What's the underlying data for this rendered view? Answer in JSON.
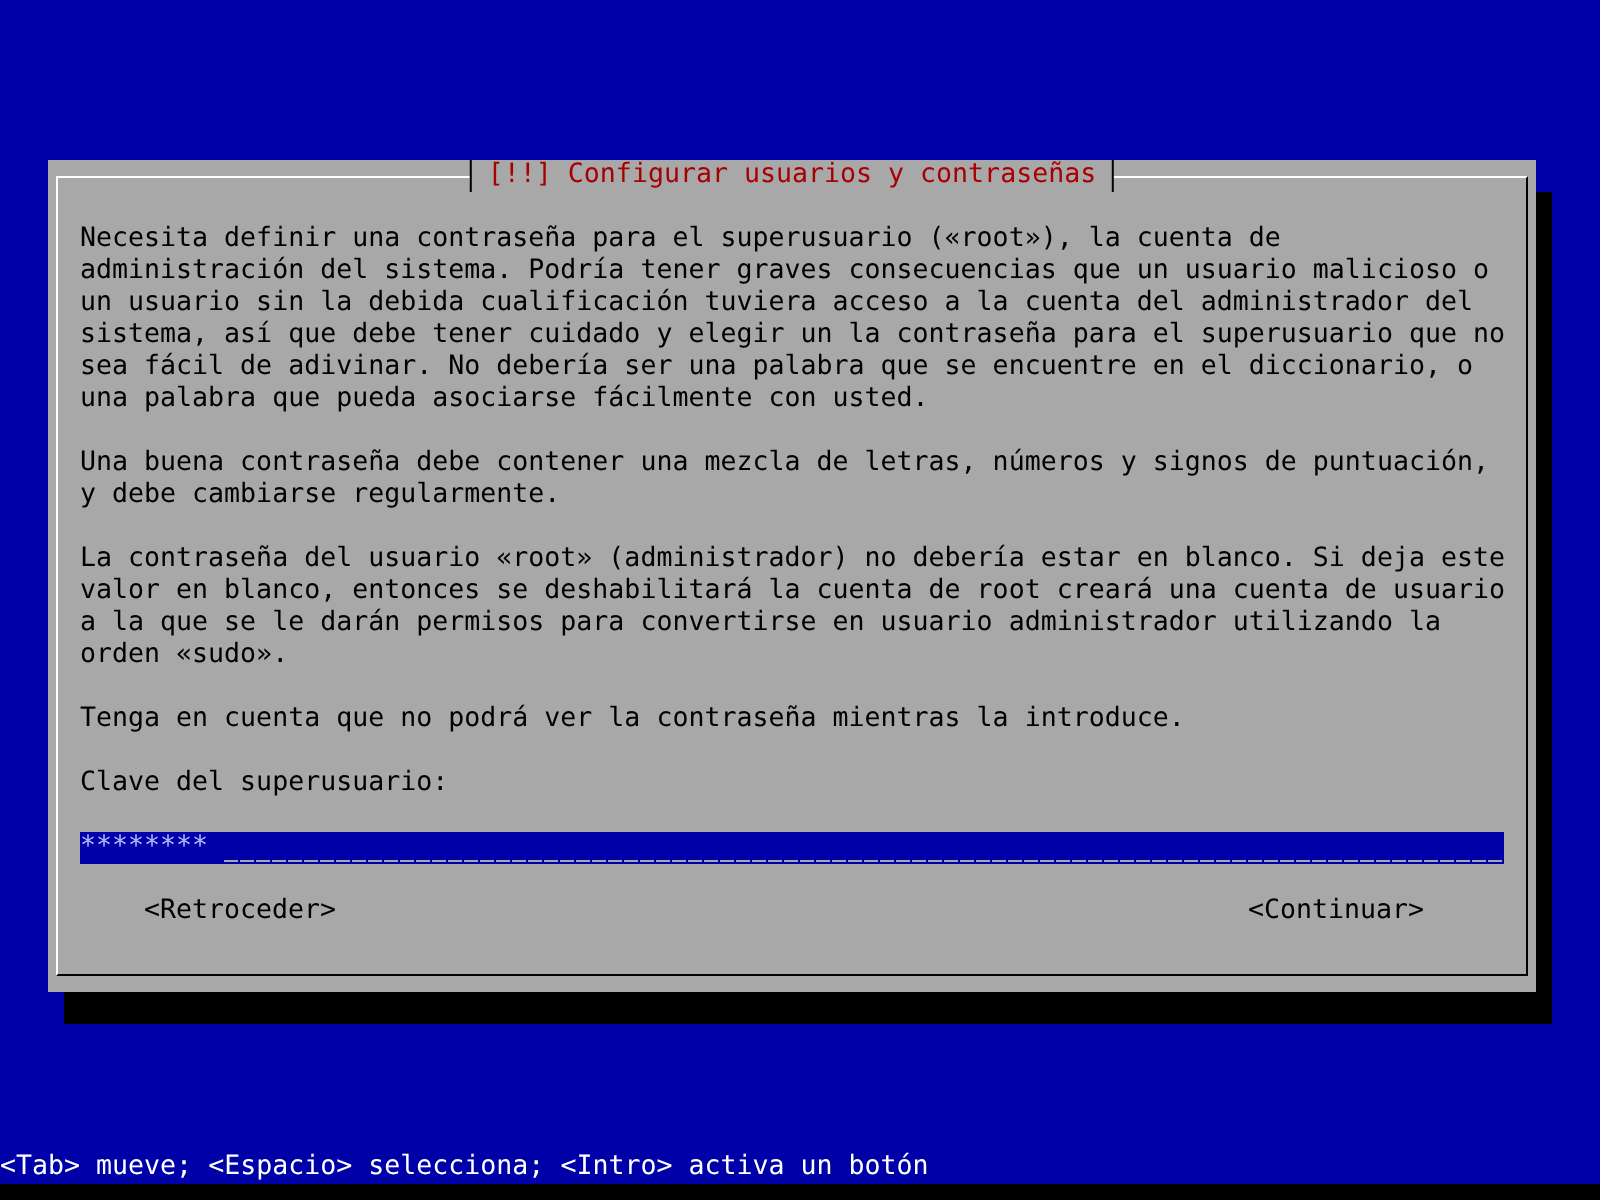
{
  "dialog": {
    "title": "[!!] Configurar usuarios y contraseñas",
    "paragraphs": [
      "Necesita definir una contraseña para el superusuario («root»), la cuenta de administración del sistema. Podría tener graves consecuencias que un usuario malicioso o un usuario sin la debida cualificación tuviera acceso a la cuenta del administrador del sistema, así que debe tener cuidado y elegir un la contraseña para el superusuario que no sea fácil de adivinar. No debería ser una palabra que se encuentre en el diccionario, o una palabra que pueda asociarse fácilmente con usted.",
      "Una buena contraseña debe contener una mezcla de letras, números y signos de puntuación, y debe cambiarse regularmente.",
      "La contraseña del usuario «root» (administrador) no debería estar en blanco. Si deja este valor en blanco, entonces se deshabilitará la cuenta de root creará una cuenta de usuario a la que se le darán permisos para convertirse en usuario administrador utilizando la orden «sudo».",
      "Tenga en cuenta que no podrá ver la contraseña mientras la introduce."
    ],
    "field": {
      "label": "Clave del superusuario:",
      "value": "********"
    },
    "buttons": [
      "<Retroceder>",
      "<Continuar>"
    ]
  },
  "status_bar": "<Tab> mueve; <Espacio> selecciona; <Intro> activa un botón"
}
